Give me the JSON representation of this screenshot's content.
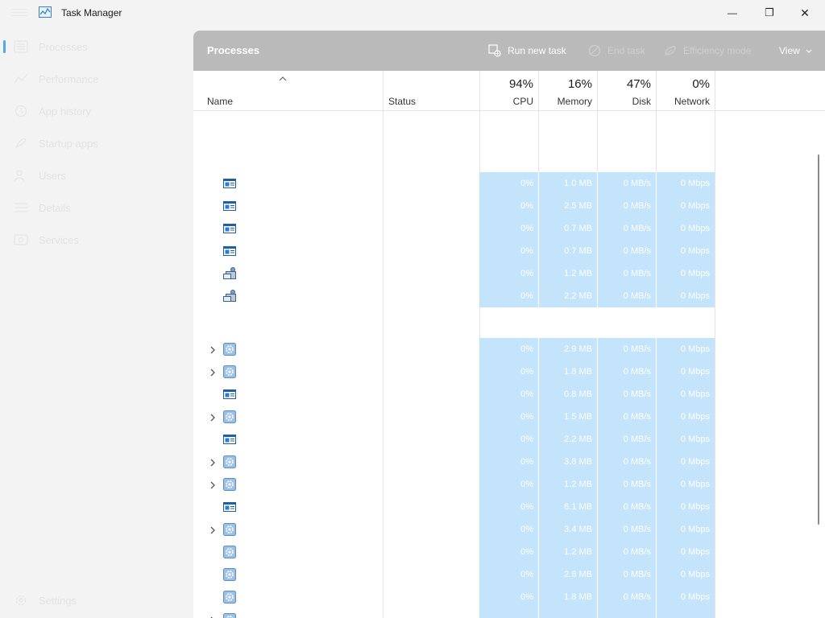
{
  "window": {
    "title": "Task Manager",
    "controls": {
      "minimize": "—",
      "maximize": "❐",
      "close": "✕"
    }
  },
  "sidebar": {
    "items": [
      {
        "label": "Processes",
        "icon": "processes-icon",
        "active": true
      },
      {
        "label": "Performance",
        "icon": "performance-icon"
      },
      {
        "label": "App history",
        "icon": "app-history-icon"
      },
      {
        "label": "Startup apps",
        "icon": "startup-apps-icon"
      },
      {
        "label": "Users",
        "icon": "users-icon"
      },
      {
        "label": "Details",
        "icon": "details-icon"
      },
      {
        "label": "Services",
        "icon": "services-icon"
      }
    ],
    "settings": {
      "label": "Settings",
      "icon": "gear-icon"
    }
  },
  "toolbar": {
    "title": "Processes",
    "run_new_task": "Run new task",
    "end_task": "End task",
    "efficiency_mode": "Efficiency mode",
    "view": "View"
  },
  "columns": {
    "name": "Name",
    "status": "Status",
    "cpu": {
      "percent": "94%",
      "label": "CPU"
    },
    "memory": {
      "percent": "16%",
      "label": "Memory"
    },
    "disk": {
      "percent": "47%",
      "label": "Disk"
    },
    "network": {
      "percent": "0%",
      "label": "Network"
    }
  },
  "colors": {
    "highlight": "#c4e4fb",
    "accent": "#4fa7f3",
    "command_bar": "#bababa"
  },
  "rows": [
    {
      "icon": "app-window-icon",
      "expandable": false,
      "cpu": "0%",
      "memory": "1.0 MB",
      "disk": "0 MB/s",
      "network": "0 Mbps"
    },
    {
      "icon": "app-window-icon",
      "expandable": false,
      "cpu": "0%",
      "memory": "2.5 MB",
      "disk": "0 MB/s",
      "network": "0 Mbps"
    },
    {
      "icon": "app-window-icon",
      "expandable": false,
      "cpu": "0%",
      "memory": "0.7 MB",
      "disk": "0 MB/s",
      "network": "0 Mbps"
    },
    {
      "icon": "app-window-icon",
      "expandable": false,
      "cpu": "0%",
      "memory": "0.7 MB",
      "disk": "0 MB/s",
      "network": "0 Mbps"
    },
    {
      "icon": "service-host-icon",
      "expandable": false,
      "cpu": "0%",
      "memory": "1.2 MB",
      "disk": "0 MB/s",
      "network": "0 Mbps"
    },
    {
      "icon": "service-host-icon",
      "expandable": false,
      "cpu": "0%",
      "memory": "2.2 MB",
      "disk": "0 MB/s",
      "network": "0 Mbps"
    },
    {
      "icon": "gear-icon",
      "expandable": true,
      "cpu": "0%",
      "memory": "2.9 MB",
      "disk": "0 MB/s",
      "network": "0 Mbps"
    },
    {
      "icon": "gear-icon",
      "expandable": true,
      "cpu": "0%",
      "memory": "1.8 MB",
      "disk": "0 MB/s",
      "network": "0 Mbps"
    },
    {
      "icon": "app-window-icon",
      "expandable": false,
      "cpu": "0%",
      "memory": "0.8 MB",
      "disk": "0 MB/s",
      "network": "0 Mbps"
    },
    {
      "icon": "gear-icon",
      "expandable": true,
      "cpu": "0%",
      "memory": "1.5 MB",
      "disk": "0 MB/s",
      "network": "0 Mbps"
    },
    {
      "icon": "app-window-icon",
      "expandable": false,
      "cpu": "0%",
      "memory": "2.2 MB",
      "disk": "0 MB/s",
      "network": "0 Mbps"
    },
    {
      "icon": "gear-icon",
      "expandable": true,
      "cpu": "0%",
      "memory": "3.8 MB",
      "disk": "0 MB/s",
      "network": "0 Mbps"
    },
    {
      "icon": "gear-icon",
      "expandable": true,
      "cpu": "0%",
      "memory": "1.2 MB",
      "disk": "0 MB/s",
      "network": "0 Mbps"
    },
    {
      "icon": "app-window-icon",
      "expandable": false,
      "cpu": "0%",
      "memory": "6.1 MB",
      "disk": "0 MB/s",
      "network": "0 Mbps"
    },
    {
      "icon": "gear-icon",
      "expandable": true,
      "cpu": "0%",
      "memory": "3.4 MB",
      "disk": "0 MB/s",
      "network": "0 Mbps"
    },
    {
      "icon": "gear-icon",
      "expandable": false,
      "cpu": "0%",
      "memory": "1.2 MB",
      "disk": "0 MB/s",
      "network": "0 Mbps"
    },
    {
      "icon": "gear-icon",
      "expandable": false,
      "cpu": "0%",
      "memory": "2.6 MB",
      "disk": "0 MB/s",
      "network": "0 Mbps"
    },
    {
      "icon": "gear-icon",
      "expandable": false,
      "cpu": "0%",
      "memory": "1.8 MB",
      "disk": "0 MB/s",
      "network": "0 Mbps"
    },
    {
      "icon": "gear-icon",
      "expandable": true,
      "cpu": "",
      "memory": "",
      "disk": "",
      "network": ""
    }
  ]
}
